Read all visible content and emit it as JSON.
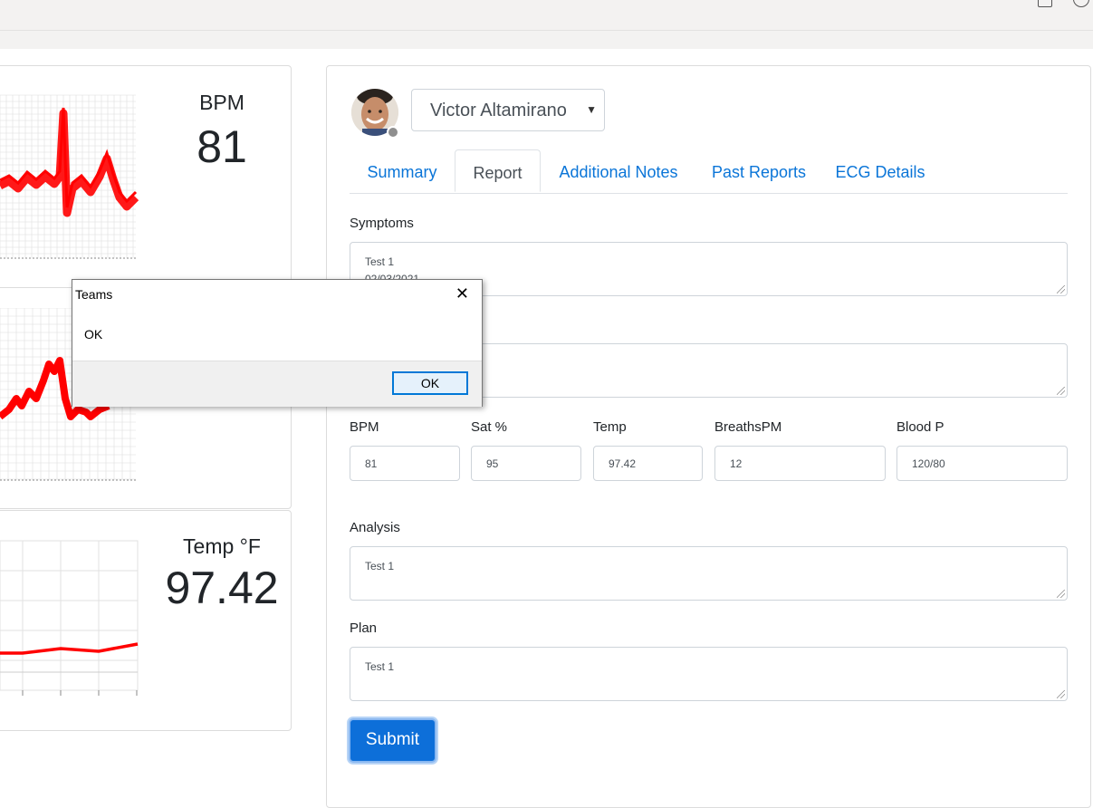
{
  "vitals": {
    "bpm": {
      "label": "BPM",
      "value": "81"
    },
    "temp": {
      "label": "Temp °F",
      "value": "97.42"
    }
  },
  "patient": {
    "name": "Victor Altamirano",
    "status": "offline"
  },
  "tabs": [
    {
      "label": "Summary",
      "active": false
    },
    {
      "label": "Report",
      "active": true
    },
    {
      "label": "Additional Notes",
      "active": false
    },
    {
      "label": "Past Reports",
      "active": false
    },
    {
      "label": "ECG Details",
      "active": false
    }
  ],
  "form": {
    "symptoms": {
      "label": "Symptoms",
      "line1": "Test 1",
      "line2": "02/03/2021"
    },
    "second_field": {
      "value": ""
    },
    "vitals": [
      {
        "label": "BPM",
        "value": "81"
      },
      {
        "label": "Sat %",
        "value": "95"
      },
      {
        "label": "Temp",
        "value": "97.42"
      },
      {
        "label": "BreathsPM",
        "value": "12"
      },
      {
        "label": "Blood P",
        "value": "120/80"
      }
    ],
    "analysis": {
      "label": "Analysis",
      "value": "Test 1"
    },
    "plan": {
      "label": "Plan",
      "value": "Test 1"
    },
    "submit_label": "Submit"
  },
  "dialog": {
    "title": "Teams",
    "message": "OK",
    "ok_label": "OK",
    "close_glyph": "✕"
  },
  "colors": {
    "trace": "#ff0000",
    "accent": "#0d6fd9",
    "link": "#0a75d8"
  }
}
